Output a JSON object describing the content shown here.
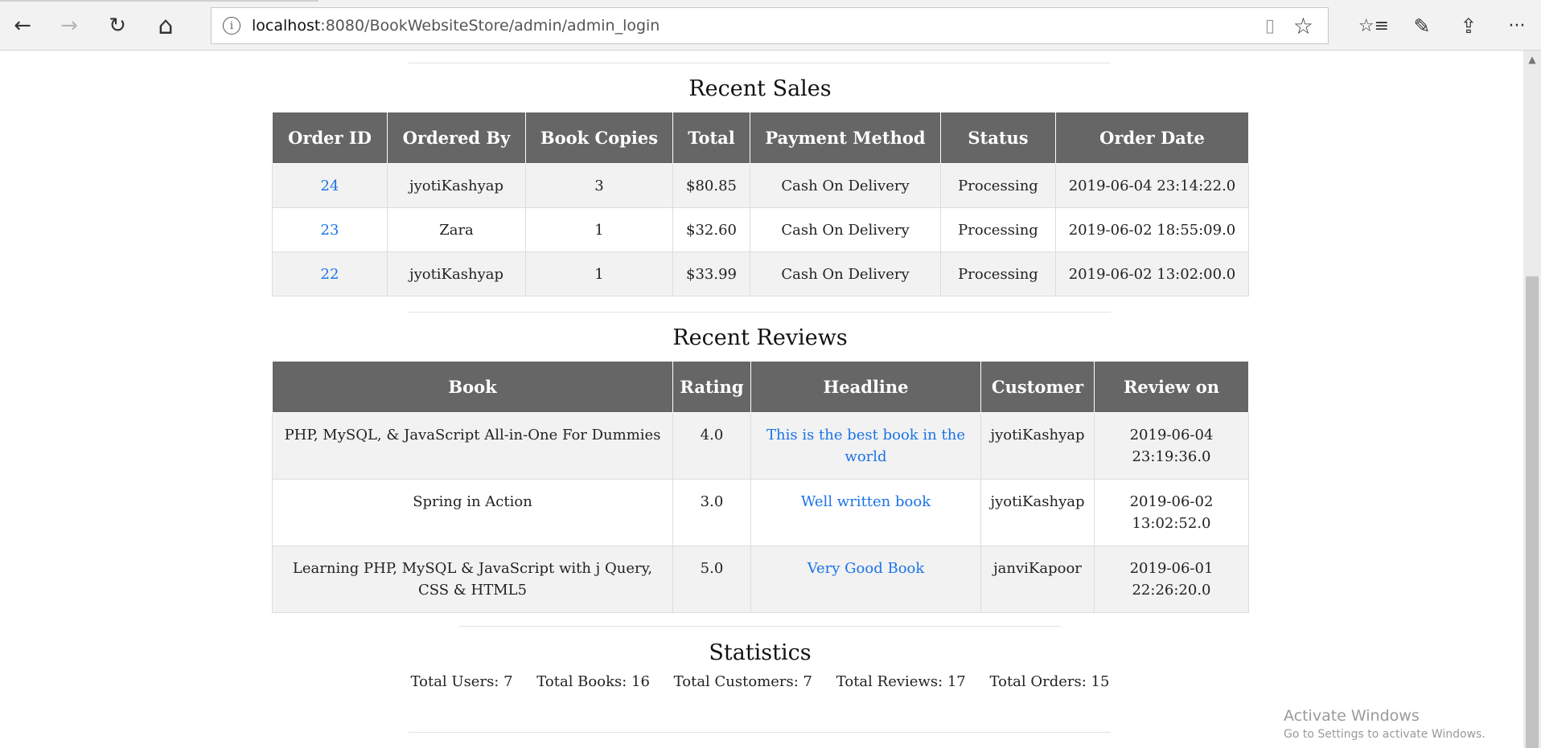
{
  "browser": {
    "url_host": "localhost",
    "url_path": ":8080/BookWebsiteStore/admin/admin_login",
    "buttons": {
      "back": "←",
      "forward": "→",
      "refresh": "↻",
      "home": "⌂",
      "reader": "▯",
      "favorite": "☆",
      "favorites_hub": "☆≡",
      "notes": "✎",
      "share": "⇪",
      "more": "···"
    }
  },
  "recent_sales": {
    "title": "Recent Sales",
    "headers": [
      "Order ID",
      "Ordered By",
      "Book Copies",
      "Total",
      "Payment Method",
      "Status",
      "Order Date"
    ],
    "rows": [
      {
        "id": "24",
        "by": "jyotiKashyap",
        "copies": "3",
        "total": "$80.85",
        "payment": "Cash On Delivery",
        "status": "Processing",
        "date": "2019-06-04 23:14:22.0"
      },
      {
        "id": "23",
        "by": "Zara",
        "copies": "1",
        "total": "$32.60",
        "payment": "Cash On Delivery",
        "status": "Processing",
        "date": "2019-06-02 18:55:09.0"
      },
      {
        "id": "22",
        "by": "jyotiKashyap",
        "copies": "1",
        "total": "$33.99",
        "payment": "Cash On Delivery",
        "status": "Processing",
        "date": "2019-06-02 13:02:00.0"
      }
    ]
  },
  "recent_reviews": {
    "title": "Recent Reviews",
    "headers": [
      "Book",
      "Rating",
      "Headline",
      "Customer",
      "Review on"
    ],
    "rows": [
      {
        "book": "PHP, MySQL, & JavaScript All-in-One For Dummies",
        "rating": "4.0",
        "headline": "This is the best book in the world",
        "customer": "jyotiKashyap",
        "date": "2019-06-04 23:19:36.0"
      },
      {
        "book": "Spring in Action",
        "rating": "3.0",
        "headline": "Well written book",
        "customer": "jyotiKashyap",
        "date": "2019-06-02 13:02:52.0"
      },
      {
        "book": "Learning PHP, MySQL & JavaScript with j Query, CSS & HTML5",
        "rating": "5.0",
        "headline": "Very Good Book",
        "customer": "janviKapoor",
        "date": "2019-06-01 22:26:20.0"
      }
    ]
  },
  "statistics": {
    "title": "Statistics",
    "items": [
      "Total Users: 7",
      "Total Books: 16",
      "Total Customers: 7",
      "Total Reviews: 17",
      "Total Orders: 15"
    ]
  },
  "watermark": {
    "line1": "Activate Windows",
    "line2": "Go to Settings to activate Windows."
  },
  "colors": {
    "header_bg": "#666666",
    "link": "#1a73e8",
    "row_alt": "#f2f2f2"
  }
}
